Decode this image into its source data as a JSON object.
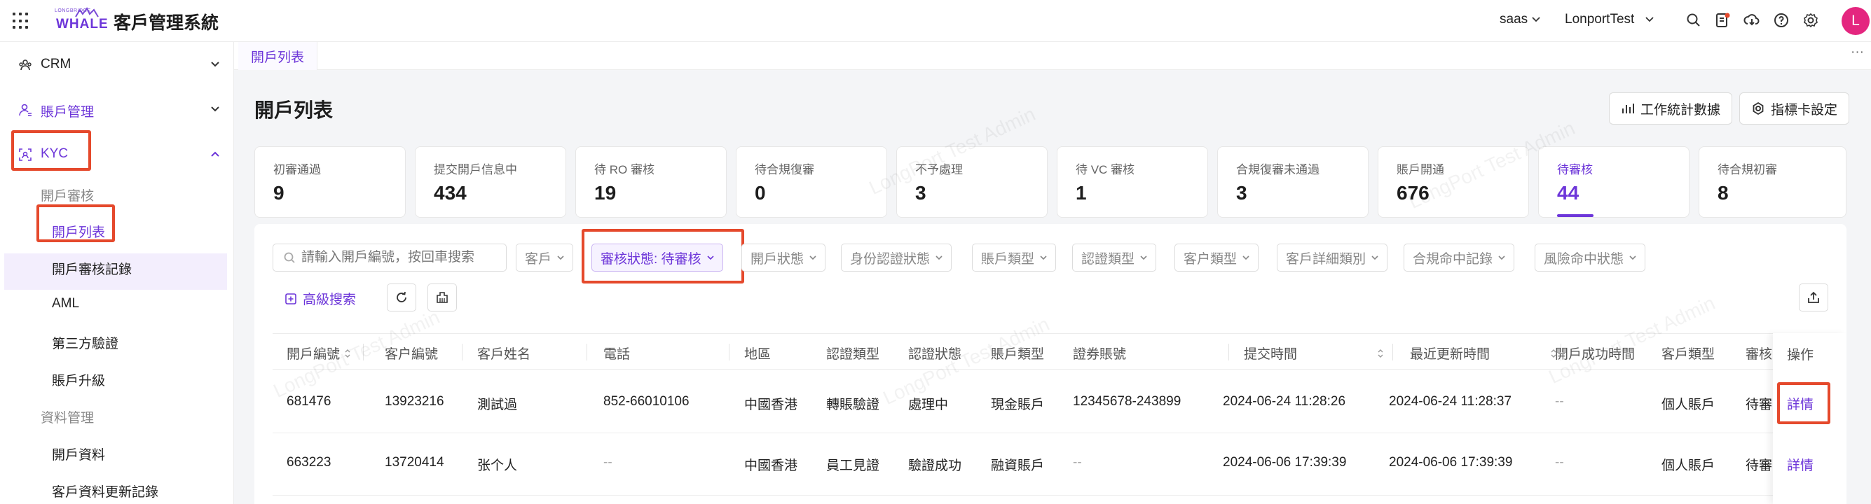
{
  "app": {
    "logo_small": "LONGBRIDGE",
    "logo_big": "WHALE",
    "title": "客戶管理系統"
  },
  "header": {
    "tenant": "saas",
    "account": "LonportTest",
    "avatar_initial": "L",
    "icons": [
      "search-icon",
      "document-icon",
      "download-icon",
      "help-icon",
      "settings-icon"
    ]
  },
  "sidebar": {
    "menus": [
      {
        "label": "CRM",
        "icon": "users-icon",
        "expanded": false
      },
      {
        "label": "賬戶管理",
        "icon": "user-icon",
        "expanded": false
      },
      {
        "label": "KYC",
        "icon": "scan-face-icon",
        "expanded": true
      }
    ],
    "groups": [
      {
        "title": "開戶審核",
        "items": [
          "開戶列表",
          "開戶審核記錄",
          "AML",
          "第三方驗證",
          "賬戶升級"
        ]
      },
      {
        "title": "資料管理",
        "items": [
          "開戶資料",
          "客戶資料更新記錄"
        ]
      }
    ],
    "active_item": "開戶列表"
  },
  "tabs": [
    {
      "label": "開戶列表"
    }
  ],
  "tabs_more": "···",
  "page": {
    "title": "開戶列表",
    "btn_stats": "工作統計數據",
    "btn_cards": "指標卡設定"
  },
  "stats": [
    {
      "label": "初審通過",
      "value": "9"
    },
    {
      "label": "提交開戶信息中",
      "value": "434"
    },
    {
      "label": "待 RO 審核",
      "value": "19"
    },
    {
      "label": "待合規復審",
      "value": "0"
    },
    {
      "label": "不予處理",
      "value": "3"
    },
    {
      "label": "待 VC 審核",
      "value": "1"
    },
    {
      "label": "合規復審未通過",
      "value": "3"
    },
    {
      "label": "賬戶開通",
      "value": "676"
    },
    {
      "label": "待審核",
      "value": "44",
      "active": true
    },
    {
      "label": "待合規初審",
      "value": "8"
    }
  ],
  "filters": {
    "search_placeholder": "請輸入開戶編號，按回車搜索",
    "items": [
      "客戶",
      "審核狀態: 待審核",
      "開戶狀態",
      "身份認證狀態",
      "賬戶類型",
      "認證類型",
      "客户類型",
      "客戶詳細類別",
      "合規命中記錄",
      "風險命中狀態"
    ],
    "advanced": "高級搜索"
  },
  "table": {
    "columns": [
      "開戶編號",
      "客户編號",
      "客戶姓名",
      "電話",
      "地區",
      "認證類型",
      "認證狀態",
      "賬戶類型",
      "證券賬號",
      "提交時間",
      "最近更新時間",
      "開戶成功時間",
      "客戶類型",
      "審核",
      "操作"
    ],
    "rows": [
      [
        "681476",
        "13923216",
        "測試過",
        "852-66010106",
        "中國香港",
        "轉賬驗證",
        "處理中",
        "現金賬戶",
        "12345678-243899",
        "2024-06-24 11:28:26",
        "2024-06-24 11:28:37",
        "--",
        "個人賬戶",
        "待審",
        "詳情"
      ],
      [
        "663223",
        "13720414",
        "张个人",
        "--",
        "中國香港",
        "員工見證",
        "驗證成功",
        "融資賬戶",
        "--",
        "2024-06-06 17:39:39",
        "2024-06-06 17:39:39",
        "--",
        "個人賬戶",
        "待審",
        "詳情"
      ]
    ]
  },
  "watermark": "LongPort Test Admin",
  "colors": {
    "accent": "#6d36d9",
    "highlight": "#e5492c",
    "avatar": "#e4267f"
  }
}
